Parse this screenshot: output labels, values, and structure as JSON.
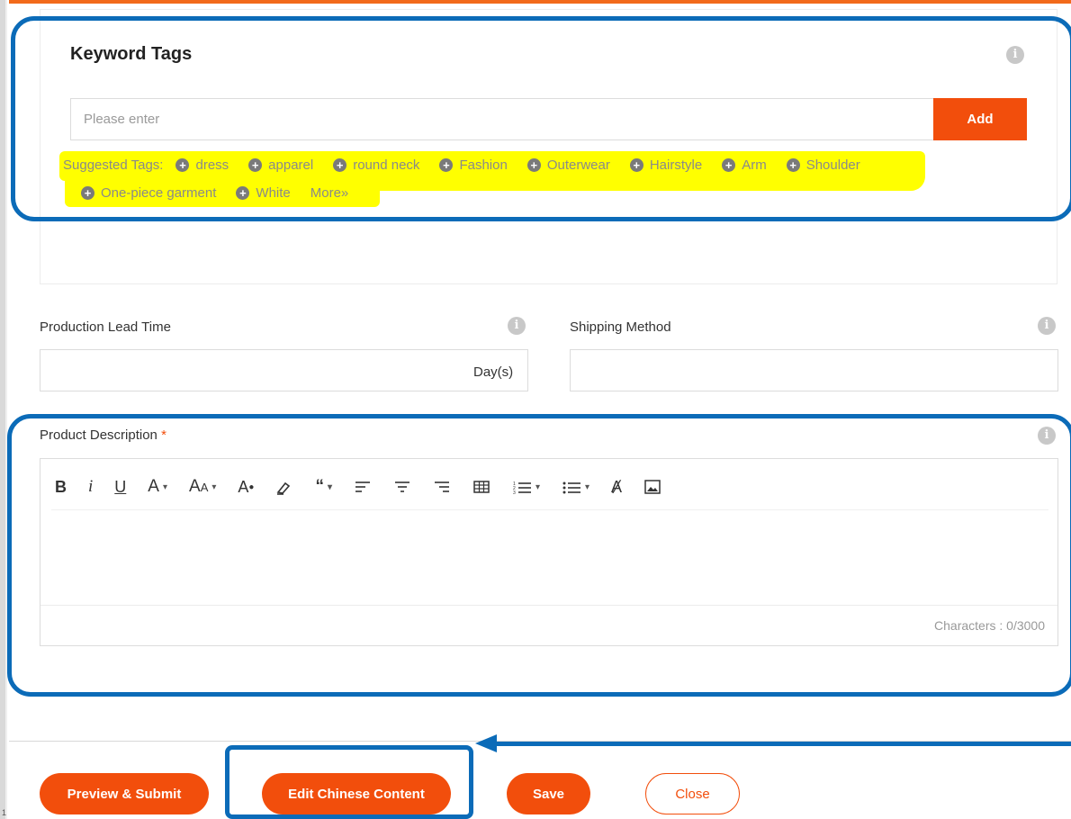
{
  "keyword_tags": {
    "title": "Keyword Tags",
    "input_placeholder": "Please enter",
    "add_label": "Add",
    "suggested_label": "Suggested Tags:",
    "suggested": [
      "dress",
      "apparel",
      "round neck",
      "Fashion",
      "Outerwear",
      "Hairstyle",
      "Arm",
      "Shoulder",
      "One-piece garment",
      "White"
    ],
    "more_label": "More»"
  },
  "production": {
    "label": "Production Lead Time",
    "unit": "Day(s)"
  },
  "shipping": {
    "label": "Shipping Method"
  },
  "description": {
    "label": "Product Description",
    "required_mark": "*",
    "toolbar_icons": [
      "bold",
      "italic",
      "underline",
      "font-color",
      "font-size",
      "highlight-color",
      "eraser",
      "quote",
      "align-left",
      "align-center",
      "align-right",
      "table",
      "ordered-list",
      "unordered-list",
      "clear-format",
      "image"
    ],
    "char_count": "Characters : 0/3000"
  },
  "footer": {
    "preview_label": "Preview & Submit",
    "edit_chinese_label": "Edit Chinese Content",
    "save_label": "Save",
    "close_label": "Close"
  },
  "page_number": "1",
  "colors": {
    "accent": "#f24e0c",
    "annotation": "#0b6bb8",
    "highlight": "#ffff00"
  }
}
